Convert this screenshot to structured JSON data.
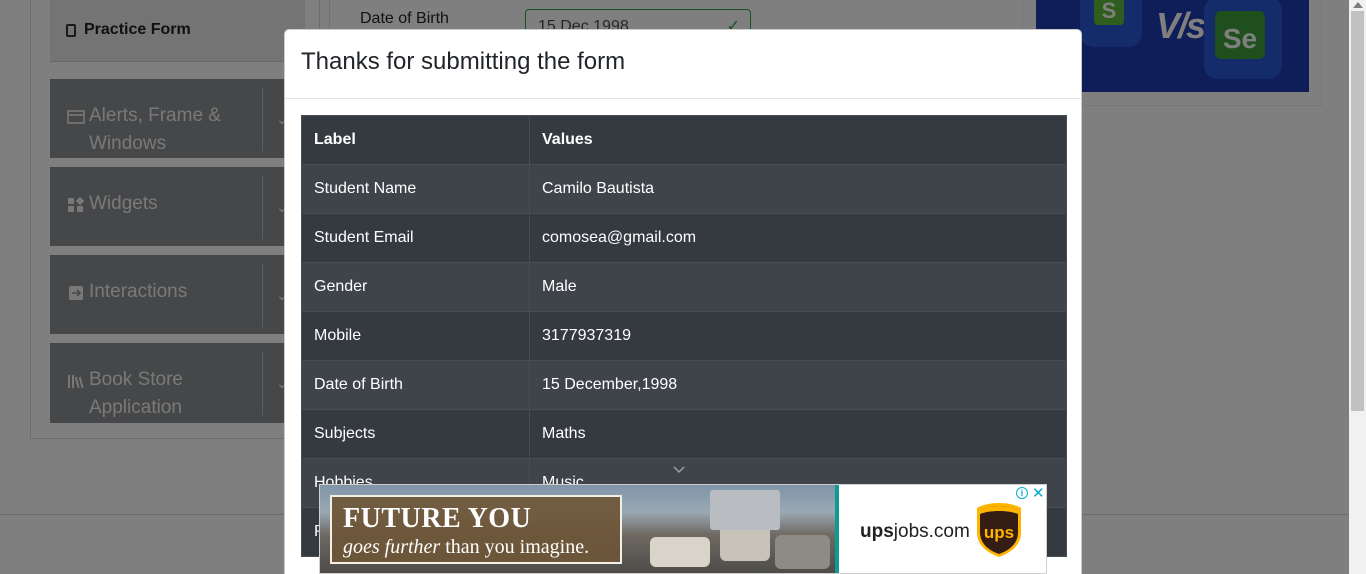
{
  "sidebar": {
    "practice_form_label": "Practice Form",
    "groups": [
      {
        "label": "Alerts, Frame &\nWindows",
        "icon": "window-icon"
      },
      {
        "label": "Widgets",
        "icon": "widgets-icon"
      },
      {
        "label": "Interactions",
        "icon": "interactions-icon"
      },
      {
        "label": "Book Store\nApplication",
        "icon": "book-icon"
      }
    ]
  },
  "form": {
    "dob_label": "Date of Birth",
    "dob_value": "15 Dec 1998"
  },
  "banner": {
    "left_letter": "S",
    "vs_text": "V/s",
    "right_letters": "Se"
  },
  "modal": {
    "title": "Thanks for submitting the form",
    "table": {
      "headers": [
        "Label",
        "Values"
      ],
      "rows": [
        {
          "label": "Student Name",
          "value": "Camilo Bautista"
        },
        {
          "label": "Student Email",
          "value": "comosea@gmail.com"
        },
        {
          "label": "Gender",
          "value": "Male"
        },
        {
          "label": "Mobile",
          "value": "3177937319"
        },
        {
          "label": "Date of Birth",
          "value": "15 December,1998"
        },
        {
          "label": "Subjects",
          "value": "Maths"
        },
        {
          "label": "Hobbies",
          "value": "Music"
        },
        {
          "label": "P",
          "value": ""
        }
      ]
    }
  },
  "ad": {
    "headline": "FUTURE YOU",
    "subline_italic": "goes further",
    "subline_rest": " than you imagine.",
    "domain_bold": "ups",
    "domain_rest": "jobs.com",
    "logo_text": "ups",
    "info_glyph": "i",
    "close_glyph": "✕"
  },
  "colors": {
    "table_bg": "#343a40",
    "table_stripe": "#3e444a",
    "sidebar_group": "#8b8f93",
    "ad_teal": "#0c9c94",
    "ups_brown": "#351c15",
    "ups_gold": "#ffb500"
  }
}
